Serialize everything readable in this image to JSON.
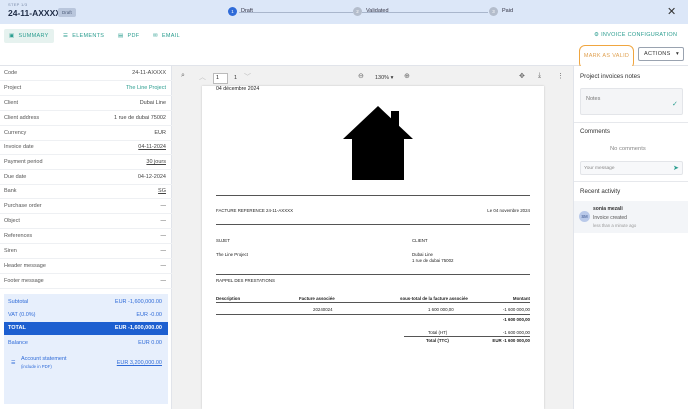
{
  "header": {
    "step_small": "STEP 1/3",
    "invoice_code": "24-11-AXXXX",
    "status_badge": "Draft",
    "steps": [
      {
        "num": "1",
        "label": "Draft"
      },
      {
        "num": "2",
        "label": "Validated"
      },
      {
        "num": "3",
        "label": "Paid"
      }
    ],
    "close": "✕"
  },
  "tabs": [
    {
      "icon": "▣",
      "label": "SUMMARY"
    },
    {
      "icon": "☰",
      "label": "ELEMENTS"
    },
    {
      "icon": "▤",
      "label": "PDF"
    },
    {
      "icon": "✉",
      "label": "EMAIL"
    }
  ],
  "toolbar": {
    "invoice_config": "INVOICE CONFIGURATION",
    "mark_valid": "MARK AS VALID",
    "actions": "ACTIONS"
  },
  "fields": [
    {
      "label": "Code",
      "value": "24-11-AXXXX"
    },
    {
      "label": "Project",
      "value": "The Line Project"
    },
    {
      "label": "Client",
      "value": "Dubai Line"
    },
    {
      "label": "Client address",
      "value": "1 rue de dubai 75002"
    },
    {
      "label": "Currency",
      "value": "EUR"
    },
    {
      "label": "Invoice date",
      "value": "04-11-2024"
    },
    {
      "label": "Payment period",
      "value": "30 jours"
    },
    {
      "label": "Due date",
      "value": "04-12-2024"
    },
    {
      "label": "Bank",
      "value": "SG"
    },
    {
      "label": "Purchase order",
      "value": "—"
    },
    {
      "label": "Object",
      "value": "—"
    },
    {
      "label": "References",
      "value": "—"
    },
    {
      "label": "Siren",
      "value": "—"
    },
    {
      "label": "Header message",
      "value": "—"
    },
    {
      "label": "Footer message",
      "value": "—"
    }
  ],
  "totals": {
    "subtotal_label": "Subtotal",
    "subtotal_value": "EUR -1,600,000.00",
    "vat_label": "VAT (0.0%)",
    "vat_value": "EUR -0.00",
    "total_label": "TOTAL",
    "total_value": "EUR -1,600,000.00",
    "balance_label": "Balance",
    "balance_value": "EUR 0.00",
    "account_label": "Account statement",
    "account_sub": "(include in PDF)",
    "account_value": "EUR 3,200,000.00"
  },
  "viewer": {
    "page_current": "1",
    "page_total": "1",
    "zoom": "130% ▾"
  },
  "document": {
    "date_top": "04 décembre 2024",
    "ref": "FACTURE REFERENCE 24-11-AXXXX",
    "date_right": "Le 04 novembre 2024",
    "subject_label": "SUJET",
    "client_label": "CLIENT",
    "subject_value": "The Line Project",
    "client_name": "Dubai Line",
    "client_addr": "1 rue de dubai 75002",
    "recall": "RAPPEL DES PRESTATIONS",
    "col_desc": "Description",
    "col_fact": "Facture associée",
    "col_sub": "sous-total de la facture associée",
    "col_amount": "Montant",
    "row_fact": "20240024",
    "row_sub": "1 600 000,00",
    "row_amount": "-1 600 000,00",
    "row_total_line": "-1 600 000,00",
    "total_ht_label": "Total (HT)",
    "total_ht_value": "-1 600 000,00",
    "total_ttc_label": "Total (TTC)",
    "total_ttc_value": "EUR -1 600 000,00"
  },
  "right": {
    "notes_title": "Project invoices notes",
    "notes_placeholder": "Notes",
    "comments_title": "Comments",
    "no_comments": "No comments",
    "message_placeholder": "Your message",
    "recent_title": "Recent activity",
    "activity": {
      "avatar": "SM",
      "name": "sonia mezali",
      "text": "Invoice created",
      "time": "less than a minute ago"
    }
  },
  "colors": {
    "accent": "#2a9d8f",
    "primary": "#2f6bd8",
    "highlight": "#f0a640"
  }
}
